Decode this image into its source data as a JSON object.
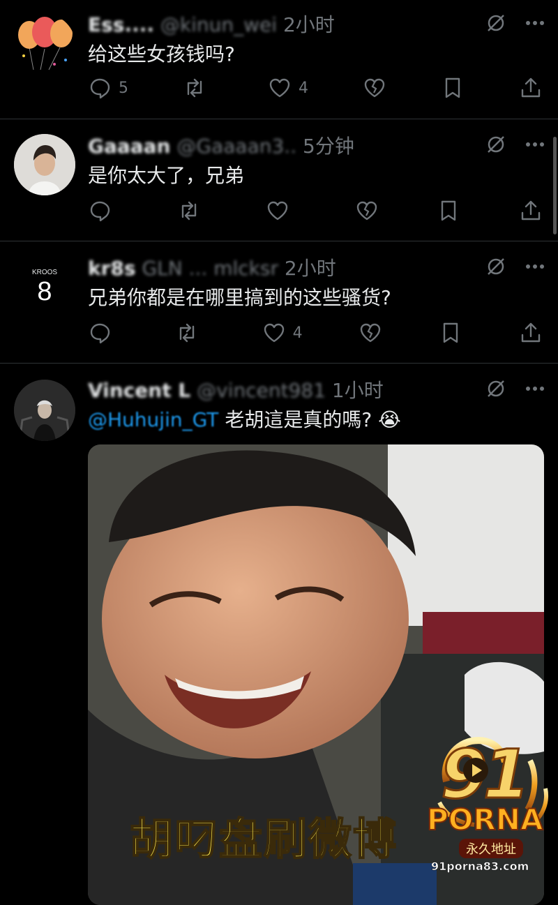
{
  "tweets": [
    {
      "name": "Ess....",
      "handle": "@kinun_wei",
      "time": "2小时",
      "text": "给这些女孩钱吗?",
      "replies": "5",
      "retweets": "",
      "likes": "4"
    },
    {
      "name": "Gaaaan",
      "handle": "@Gaaaan3..",
      "time": "5分钟",
      "text": "是你太大了，兄弟",
      "replies": "",
      "retweets": "",
      "likes": ""
    },
    {
      "name": "kr8s",
      "handle": "GLN ... mlcksr",
      "time": "2小时",
      "text": "兄弟你都是在哪里搞到的这些骚货?",
      "replies": "",
      "retweets": "",
      "likes": "4",
      "avatar_top": "KROOS",
      "avatar_num": "8"
    },
    {
      "name": "Vincent L",
      "handle": "@vincent981",
      "time": "1小时",
      "mention": "@Huhujin_GT",
      "text": "老胡這是真的嗎?",
      "emoji": "😭",
      "media_caption": "胡叼盘刷微博"
    }
  ],
  "watermark": {
    "number": "91",
    "brand": "PORNA",
    "tagline": "永久地址",
    "url": "91porna83.com"
  },
  "colors": {
    "background": "#000000",
    "text": "#e7e9ea",
    "muted": "#71767b",
    "link": "#1d9bf0",
    "caption": "#f4e04a"
  }
}
